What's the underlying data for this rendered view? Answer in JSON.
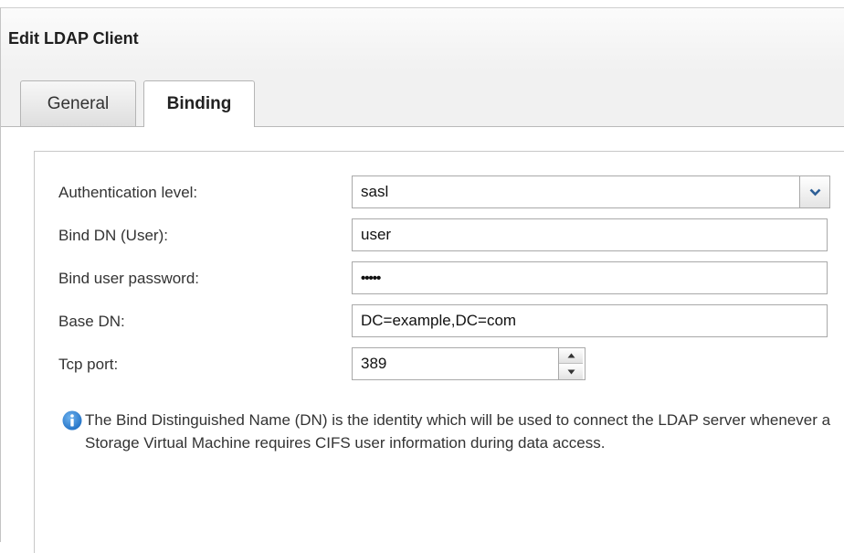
{
  "dialog": {
    "title": "Edit LDAP Client"
  },
  "tabs": [
    {
      "label": "General",
      "active": false
    },
    {
      "label": "Binding",
      "active": true
    }
  ],
  "form": {
    "auth_level_label": "Authentication level:",
    "auth_level_value": "sasl",
    "bind_dn_label": "Bind DN (User):",
    "bind_dn_value": "user",
    "password_label": "Bind user password:",
    "password_value": "•••••",
    "base_dn_label": "Base DN:",
    "base_dn_value": "DC=example,DC=com",
    "tcp_port_label": "Tcp port:",
    "tcp_port_value": "389"
  },
  "info": {
    "icon": "info-icon",
    "text": "The Bind Distinguished Name (DN) is the identity which will be used to connect the LDAP server whenever a Storage Virtual Machine requires CIFS user information during data access."
  },
  "colors": {
    "accent_blue": "#2e7fd4",
    "dropdown_arrow": "#2d5f96"
  }
}
